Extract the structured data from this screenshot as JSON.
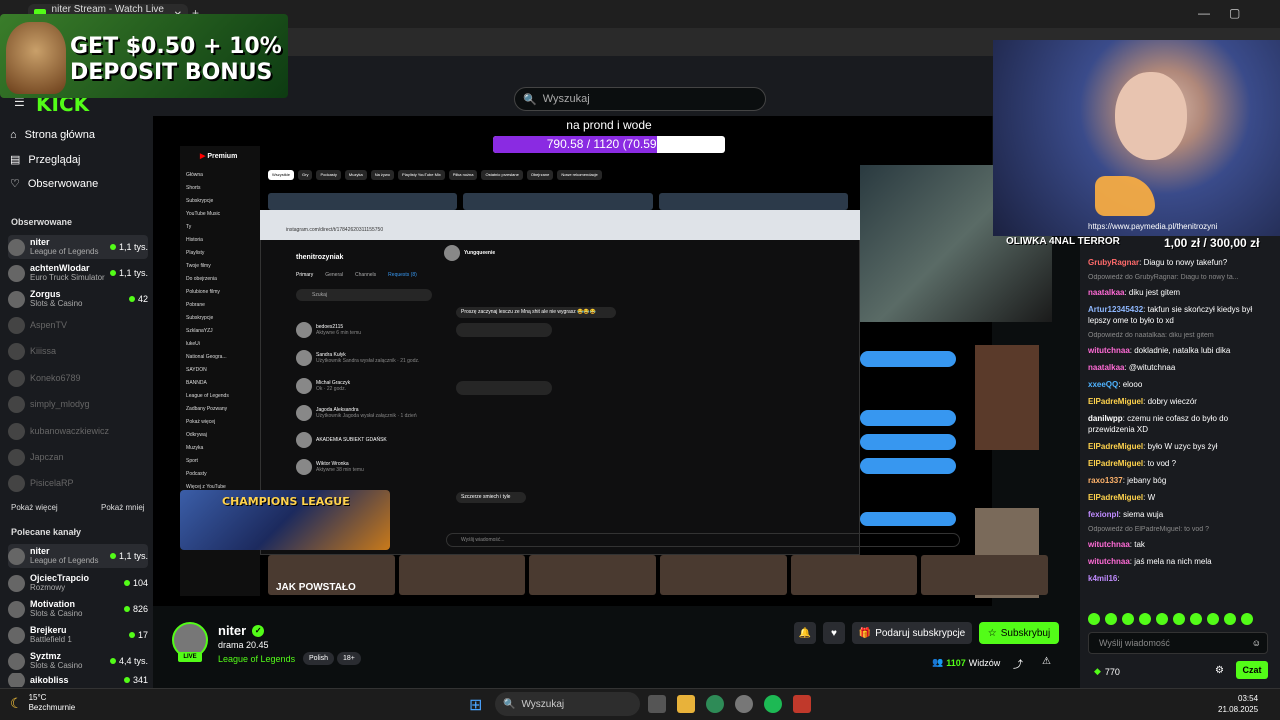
{
  "browser": {
    "tab_title": "niter Stream - Watch Live o",
    "close_glyph": "✕",
    "new_tab_glyph": "+",
    "minimize_glyph": "—",
    "maximize_glyph": "▢",
    "window_close_glyph": "✕"
  },
  "promo": {
    "text": "GET $0.50 + 10% DEPOSIT BONUS"
  },
  "header": {
    "logo": "KICK",
    "search_placeholder": "Wyszukaj"
  },
  "nav": [
    {
      "label": "Strona główna",
      "icon": "home-icon"
    },
    {
      "label": "Przeglądaj",
      "icon": "browse-icon"
    },
    {
      "label": "Obserwowane",
      "icon": "heart-icon"
    }
  ],
  "followed": {
    "title": "Obserwowane",
    "channels": [
      {
        "name": "niter",
        "category": "League of Legends",
        "viewers": "1,1 tys.",
        "live": true
      },
      {
        "name": "achtenWlodar",
        "category": "Euro Truck Simulator",
        "viewers": "1,1 tys.",
        "live": true
      },
      {
        "name": "Zorgus",
        "category": "Slots & Casino",
        "viewers": "42",
        "live": true
      },
      {
        "name": "AspenTV",
        "live": false
      },
      {
        "name": "Kiiissa",
        "live": false
      },
      {
        "name": "Koneko6789",
        "live": false
      },
      {
        "name": "simply_mlodyg",
        "live": false
      },
      {
        "name": "kubanowaczkiewicz",
        "live": false
      },
      {
        "name": "Japczan",
        "live": false
      },
      {
        "name": "PisicelaRP",
        "live": false
      }
    ],
    "show_more": "Pokaż więcej",
    "show_less": "Pokaż mniej"
  },
  "recommended": {
    "title": "Polecane kanały",
    "channels": [
      {
        "name": "niter",
        "category": "League of Legends",
        "viewers": "1,1 tys."
      },
      {
        "name": "OjciecTrapcio",
        "category": "Rozmowy",
        "viewers": "104"
      },
      {
        "name": "Motivation",
        "category": "Slots & Casino",
        "viewers": "826"
      },
      {
        "name": "Brejkeru",
        "category": "Battlefield 1",
        "viewers": "17"
      },
      {
        "name": "Syztmz",
        "category": "Slots & Casino",
        "viewers": "4,4 tys."
      },
      {
        "name": "aikobliss",
        "category": "",
        "viewers": "341"
      }
    ]
  },
  "player": {
    "overlay_title": "na prond i wode",
    "progress_text": "790.58 / 1120 (70.59%)",
    "progress_fraction": 0.7059,
    "yt_logo": "Premium",
    "yt_sidebar": [
      "Główna",
      "Shorts",
      "Subskrypcje",
      "YouTube Music",
      "Ty",
      "Historia",
      "Playlisty",
      "Twoje filmy",
      "Do obejrzenia",
      "Polubione filmy",
      "Pobrane",
      "Subskrypcje",
      "SzklanaYZJ",
      "lukeUi",
      "National Geogra...",
      "SAYDON",
      "BANNDA",
      "League of Legends",
      "Zadbany Pozwany",
      "Pokaż więcej",
      "Odkrywaj",
      "Muzyka",
      "Sport",
      "Podcasty",
      "Więcej z YouTube"
    ],
    "yt_chips": [
      "Wszystkie",
      "Gry",
      "Podcasty",
      "Muzyka",
      "Na żywo",
      "Playlisty YouTube Mix",
      "Piłka nożna",
      "Ostatnio przesłane",
      "Obejrzane",
      "Nowe rekomendacje"
    ],
    "ig_url": "instagram.com/direct/t/17842620311155750",
    "ig_user": "thenitrozyniak",
    "ig_tabs": [
      "Primary",
      "General",
      "Channels",
      "Requests (8)"
    ],
    "ig_search": "Szukaj",
    "ig_chats": [
      {
        "name": "bedoes2115",
        "sub": "Aktywne 6 min temu"
      },
      {
        "name": "Sandra Kułyk",
        "sub": "Użytkownik Sandra wysłał załącznik · 21 godz."
      },
      {
        "name": "Michał Graczyk",
        "sub": "Ok · 22 godz."
      },
      {
        "name": "Jagoda Aleksandra",
        "sub": "Użytkownik Jagoda wysłał załącznik · 1 dzień"
      },
      {
        "name": "AKADEMIA SUBIEKT GDAŃSK",
        "sub": ""
      },
      {
        "name": "Wiktor Wronka",
        "sub": "Aktywne 38 min temu"
      }
    ],
    "ig_thread_name": "Yungqueenie",
    "ig_msgs": [
      "Proszę zaczynaj lesczu ze Mną shit ale nie wygrasz 😂😂😂",
      "Szczerze smiech i tyle"
    ],
    "ig_input": "Wyślij wiadomość...",
    "champions": "CHAMPIONS LEAGUE",
    "bottom_thumb_text": "JAK POWSTAŁO"
  },
  "cam": {
    "overlay_left": "OLIWKA 4NAL TERROR",
    "overlay_right": "1,00 zł / 300,00 zł"
  },
  "chat": {
    "banner": "https://www.paymedia.pl/thenitrozyni",
    "messages": [
      {
        "user": "GrubyRagnar",
        "text": "Diagu to nowy takefun?",
        "color": "#ff6b6b"
      },
      {
        "reply": "Odpowiedź do GrubyRagnar: Diagu to nowy ta..."
      },
      {
        "user": "naatalkaa",
        "text": "diku jest gitem",
        "color": "#ff6bd6"
      },
      {
        "user": "Artur12345432",
        "text": "takfun sie skończył kiedys był lepszy ome to było to xd",
        "color": "#8fb8ff"
      },
      {
        "reply": "Odpowiedź do naatalkaa: diku jest gitem"
      },
      {
        "user": "witutchnaa",
        "text": "dokladnie, natalka lubi dika",
        "color": "#ff6bd6"
      },
      {
        "user": "naatalkaa",
        "text": "@witutchnaa",
        "color": "#ff6bd6"
      },
      {
        "user": "xxeeQQ",
        "text": "elooo",
        "color": "#4fb3ff"
      },
      {
        "user": "ElPadreMiguel",
        "text": "dobry wieczór",
        "color": "#ffd34d"
      },
      {
        "user": "danilwpp",
        "text": "czemu nie cofasz do było do przewidzenia XD",
        "color": "#ffffff"
      },
      {
        "user": "ElPadreMiguel",
        "text": "było W uzyc bys żył",
        "color": "#ffd34d"
      },
      {
        "user": "ElPadreMiguel",
        "text": "to vod ?",
        "color": "#ffd34d"
      },
      {
        "user": "raxo1337",
        "text": "jebany bóg",
        "color": "#ffb36b"
      },
      {
        "user": "ElPadreMiguel",
        "text": "W",
        "color": "#ffd34d"
      },
      {
        "user": "fexionpl",
        "text": "siema wuja",
        "color": "#c08bff"
      },
      {
        "reply": "Odpowiedź do ElPadreMiguel: to vod ?"
      },
      {
        "user": "witutchnaa",
        "text": "tak",
        "color": "#ff6bd6"
      },
      {
        "user": "witutchnaa",
        "text": "jaś mela na nich mela",
        "color": "#ff6bd6"
      },
      {
        "user": "k4mil16",
        "text": "",
        "color": "#c08bff"
      }
    ],
    "input_placeholder": "Wyślij wiadomość",
    "points": "770",
    "send_label": "Czat"
  },
  "stream": {
    "streamer": "niter",
    "live_badge": "LIVE",
    "title": "drama 20.45",
    "category": "League of Legends",
    "tags": [
      "Polish",
      "18+"
    ],
    "gift_label": "Podaruj subskrypcje",
    "subscribe_label": "Subskrybuj",
    "viewers_count": "1107",
    "viewers_label": "Widzów"
  },
  "taskbar": {
    "temp": "15°C",
    "weather": "Bezchmurnie",
    "search": "Wyszukaj",
    "time": "03:54",
    "date": "21.08.2025"
  }
}
